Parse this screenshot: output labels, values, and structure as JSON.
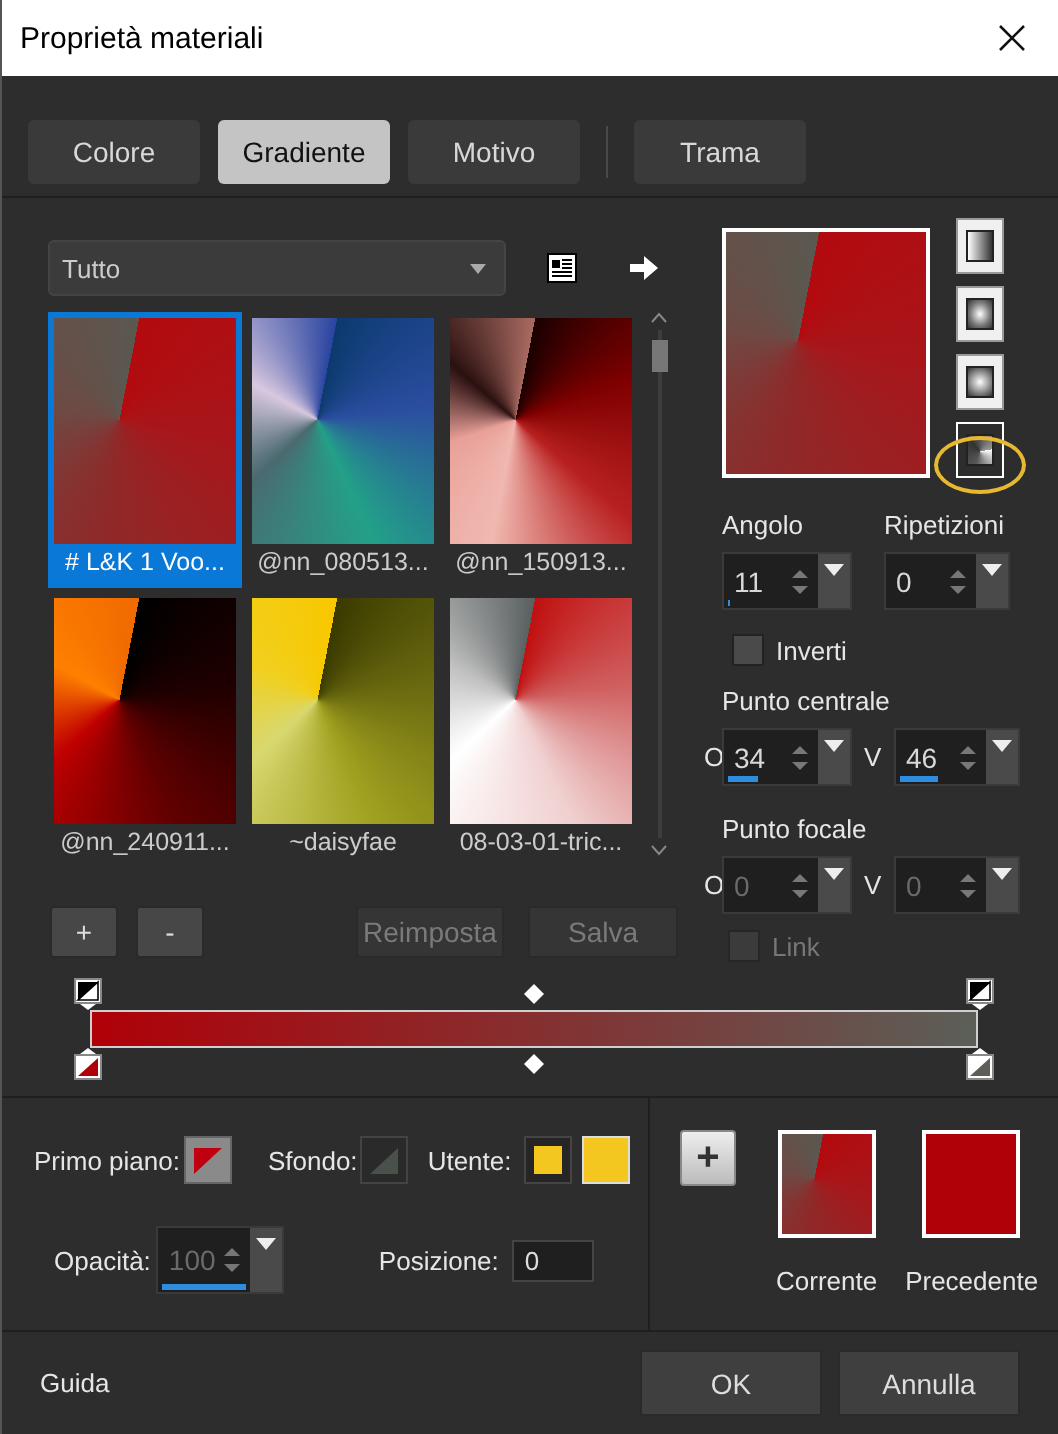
{
  "window": {
    "title": "Proprietà materiali"
  },
  "tabs": [
    {
      "label": "Colore",
      "selected": false,
      "separator_before": false
    },
    {
      "label": "Gradiente",
      "selected": true,
      "separator_before": false
    },
    {
      "label": "Motivo",
      "selected": false,
      "separator_before": false
    },
    {
      "label": "Trama",
      "selected": false,
      "separator_before": true
    }
  ],
  "library": {
    "category": "Tutto",
    "items": [
      {
        "name": "# L&K 1 Voo...",
        "selected": true
      },
      {
        "name": "@nn_080513...",
        "selected": false
      },
      {
        "name": "@nn_150913...",
        "selected": false
      },
      {
        "name": "@nn_240911...",
        "selected": false
      },
      {
        "name": "~daisyfae",
        "selected": false
      },
      {
        "name": "08-03-01-tric...",
        "selected": false
      }
    ]
  },
  "list_buttons": [
    {
      "label": "+",
      "disabled": false
    },
    {
      "label": "-",
      "disabled": false
    },
    {
      "label": "Reimposta",
      "disabled": true
    },
    {
      "label": "Salva",
      "disabled": true
    }
  ],
  "styles": [
    {
      "kind": "linear",
      "selected": false,
      "highlighted": false
    },
    {
      "kind": "rectangular",
      "selected": false,
      "highlighted": false
    },
    {
      "kind": "sunburst",
      "selected": false,
      "highlighted": false
    },
    {
      "kind": "radial",
      "selected": true,
      "highlighted": true
    }
  ],
  "angle": {
    "label": "Angolo",
    "value": "11",
    "level": 0.03
  },
  "repeats": {
    "label": "Ripetizioni",
    "value": "0"
  },
  "invert": {
    "label": "Inverti",
    "checked": false
  },
  "center": {
    "label": "Punto centrale",
    "h": {
      "label": "O",
      "value": "34",
      "level": 0.34
    },
    "v": {
      "label": "V",
      "value": "46",
      "level": 0.46
    }
  },
  "focal": {
    "label": "Punto focale",
    "disabled": true,
    "h": {
      "label": "O",
      "value": "0"
    },
    "v": {
      "label": "V",
      "value": "0"
    }
  },
  "link": {
    "label": "Link",
    "checked": false,
    "disabled": true
  },
  "gradient_bar": {
    "stops": [
      {
        "color": "#b00008"
      },
      {
        "color": "#5b5f58"
      }
    ]
  },
  "swatches": {
    "foreground": {
      "label": "Primo piano:",
      "color": "#c00010"
    },
    "background": {
      "label": "Sfondo:",
      "color": "#4a504a"
    },
    "user": {
      "label": "Utente:",
      "color": "#f4c620"
    }
  },
  "opacity": {
    "label": "Opacità:",
    "value": "100",
    "level": 1,
    "disabled": true
  },
  "position": {
    "label": "Posizione:",
    "value": "0"
  },
  "add_button": {
    "label": "+"
  },
  "current": {
    "label": "Corrente"
  },
  "previous": {
    "label": "Precedente",
    "color": "#b00008"
  },
  "footer": {
    "help": "Guida",
    "buttons": [
      "OK",
      "Annulla"
    ]
  }
}
